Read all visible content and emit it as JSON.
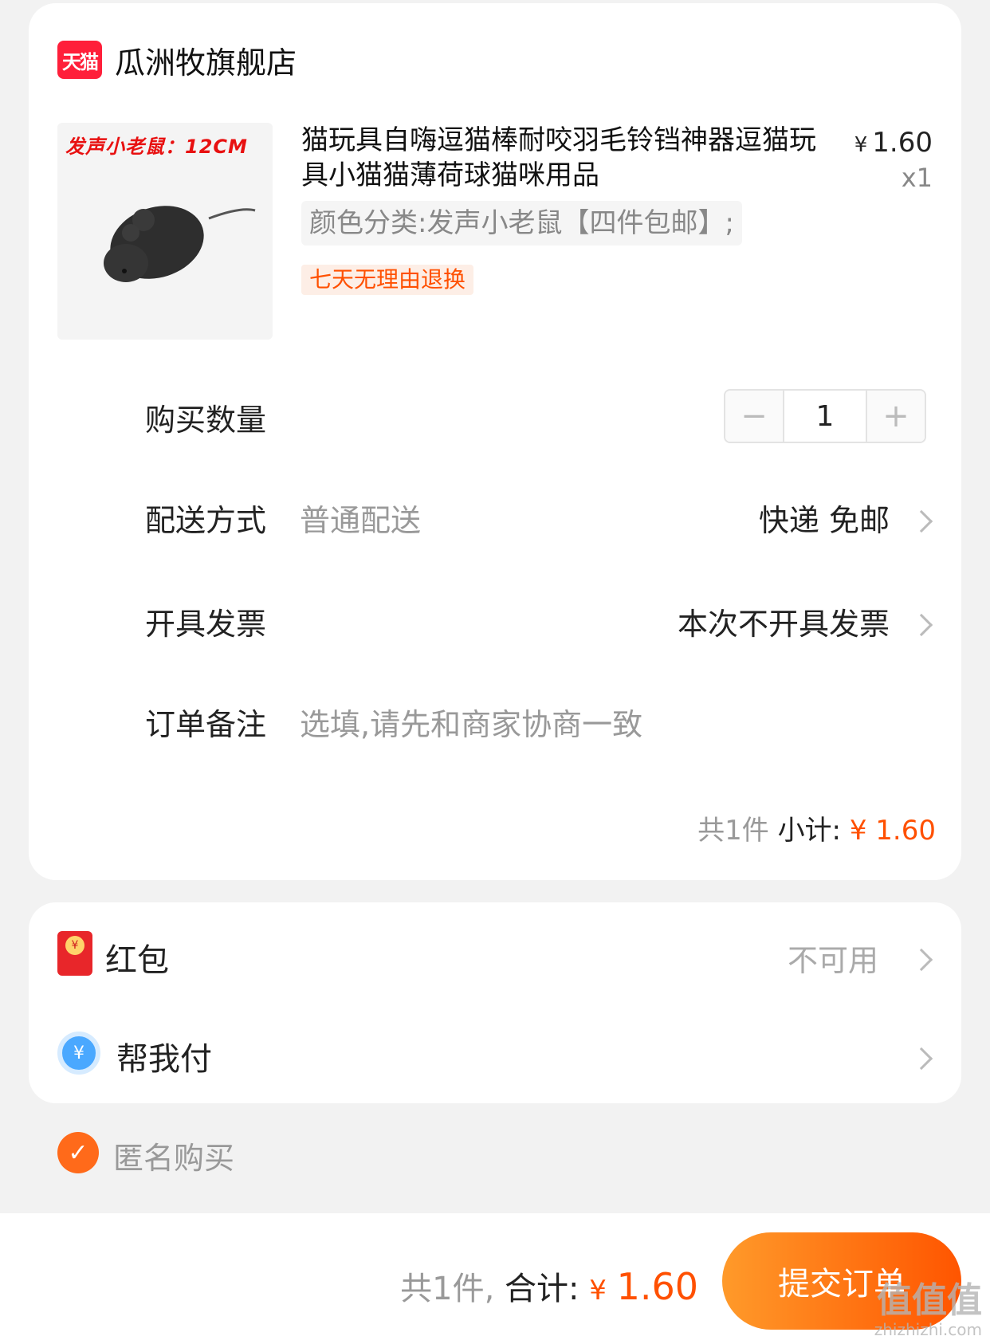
{
  "shop": {
    "badge": "天猫",
    "name": "瓜洲牧旗舰店"
  },
  "product": {
    "image_caption": "发声小老鼠：12CM",
    "title": "猫玩具自嗨逗猫棒耐咬羽毛铃铛神器逗猫玩具小猫猫薄荷球猫咪用品",
    "price_symbol": "¥",
    "price": "1.60",
    "qty": "x1",
    "sku": "颜色分类:发声小老鼠【四件包邮】;",
    "return_tag": "七天无理由退换"
  },
  "quantity": {
    "label": "购买数量",
    "minus": "−",
    "value": "1",
    "plus": "+"
  },
  "delivery": {
    "label": "配送方式",
    "method": "普通配送",
    "value": "快递 免邮"
  },
  "invoice": {
    "label": "开具发票",
    "value": "本次不开具发票"
  },
  "note": {
    "label": "订单备注",
    "placeholder": "选填,请先和商家协商一致"
  },
  "subtotal": {
    "count": "共1件",
    "label": "小计:",
    "amount": "¥ 1.60"
  },
  "redpacket": {
    "label": "红包",
    "coin": "¥",
    "status": "不可用"
  },
  "helppay": {
    "label": "帮我付",
    "icon_text": "¥"
  },
  "anonymous": {
    "check": "✓",
    "label": "匿名购买"
  },
  "bottom": {
    "count": "共1件,",
    "total_label": "合计:",
    "yen": "¥",
    "total": "1.60",
    "submit": "提交订单"
  },
  "watermark": {
    "main": "值值值",
    "sub": "zhizhizhi.com"
  },
  "colors": {
    "accent": "#ff5000",
    "tmall": "#ff1f3a"
  }
}
